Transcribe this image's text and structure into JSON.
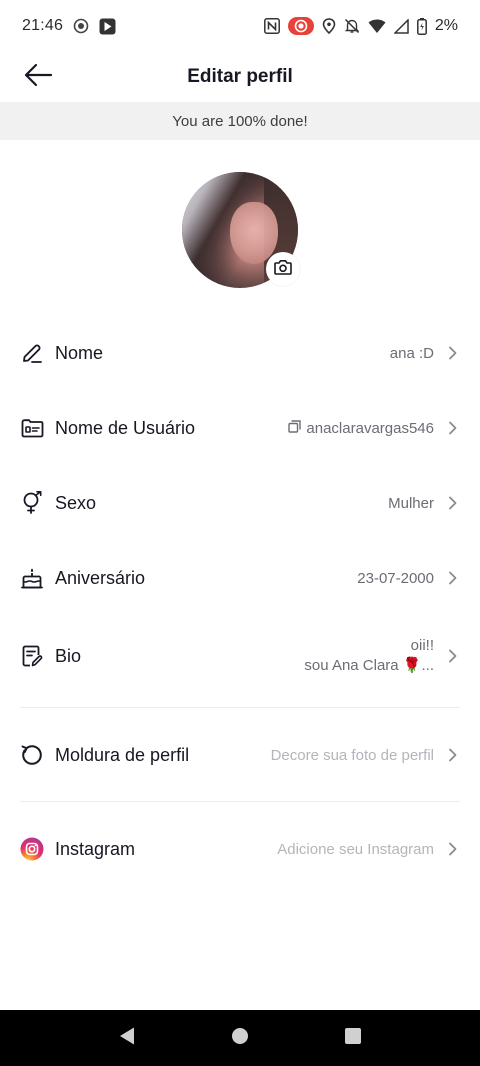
{
  "status_bar": {
    "time": "21:46",
    "battery": "2%",
    "left_icons": [
      "record-icon",
      "play-store-icon"
    ],
    "right_icons": [
      "nfc-icon",
      "screen-record-icon",
      "location-icon",
      "bell-off-icon",
      "wifi-icon",
      "signal-icon",
      "battery-icon"
    ]
  },
  "header": {
    "title": "Editar perfil",
    "back_icon": "back-arrow-icon"
  },
  "progress": {
    "text": "You are 100% done!"
  },
  "avatar": {
    "camera_icon": "camera-icon"
  },
  "rows": {
    "name": {
      "label": "Nome",
      "value": "ana :D",
      "icon": "pencil-icon"
    },
    "username": {
      "label": "Nome de Usuário",
      "value": "anaclaravargas546",
      "icon": "id-card-icon",
      "copy_icon": "copy-icon"
    },
    "gender": {
      "label": "Sexo",
      "value": "Mulher",
      "icon": "gender-icon"
    },
    "birthday": {
      "label": "Aniversário",
      "value": "23-07-2000",
      "icon": "cake-icon"
    },
    "bio": {
      "label": "Bio",
      "line1": "oii!!",
      "line2": "sou Ana Clara 🌹...",
      "icon": "bio-edit-icon"
    },
    "frame": {
      "label": "Moldura de perfil",
      "value": "Decore sua foto de perfil",
      "icon": "refresh-circle-icon"
    },
    "instagram": {
      "label": "Instagram",
      "value": "Adicione seu Instagram",
      "icon": "instagram-icon"
    }
  },
  "colors": {
    "text_primary": "#161823",
    "text_secondary": "#6b6d75",
    "placeholder": "#b4b5bb",
    "banner_bg": "#f1f1f2",
    "nav_bg": "#000000"
  }
}
